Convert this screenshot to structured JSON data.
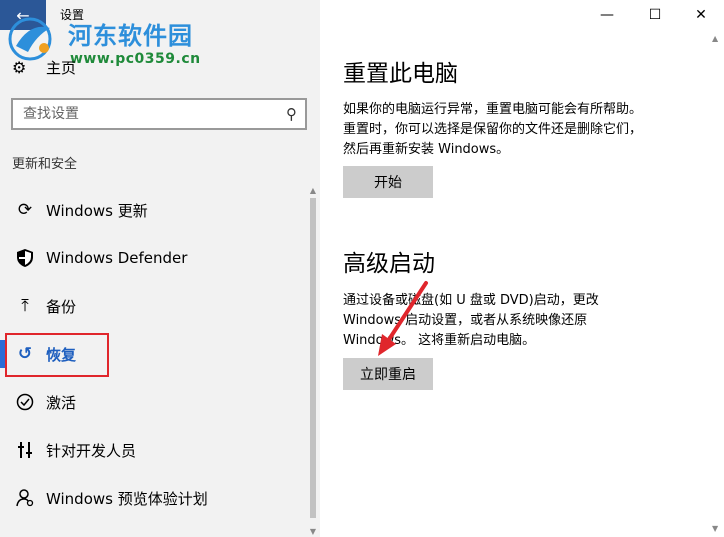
{
  "titlebar": {
    "back_icon": "arrow-left-icon",
    "app_title": "设置",
    "minimize": "—",
    "maximize": "☐",
    "close": "✕"
  },
  "watermark": {
    "name": "河东软件园",
    "url": "www.pc0359.cn"
  },
  "sidebar": {
    "home_label": "主页",
    "search_placeholder": "查找设置",
    "section_label": "更新和安全",
    "items": [
      {
        "label": "Windows 更新",
        "icon": "refresh-icon"
      },
      {
        "label": "Windows Defender",
        "icon": "shield-icon"
      },
      {
        "label": "备份",
        "icon": "upload-icon"
      },
      {
        "label": "恢复",
        "icon": "history-icon",
        "selected": true
      },
      {
        "label": "激活",
        "icon": "check-circle-icon"
      },
      {
        "label": "针对开发人员",
        "icon": "developer-icon"
      },
      {
        "label": "Windows 预览体验计划",
        "icon": "person-icon"
      }
    ]
  },
  "main": {
    "reset": {
      "title": "重置此电脑",
      "lines": [
        "如果你的电脑运行异常，重置电脑可能会有所帮助。",
        "重置时，你可以选择是保留你的文件还是删除它们，",
        "然后再重新安装 Windows。"
      ],
      "button": "开始"
    },
    "advanced": {
      "title": "高级启动",
      "lines": [
        "通过设备或磁盘(如 U 盘或 DVD)启动，更改",
        "Windows 启动设置，或者从系统映像还原",
        "Windows。 这将重新启动电脑。"
      ],
      "button": "立即重启"
    }
  },
  "colors": {
    "accent": "#2b6cd6",
    "highlight_border": "#e0262c",
    "annotation_arrow": "#e0262c"
  }
}
